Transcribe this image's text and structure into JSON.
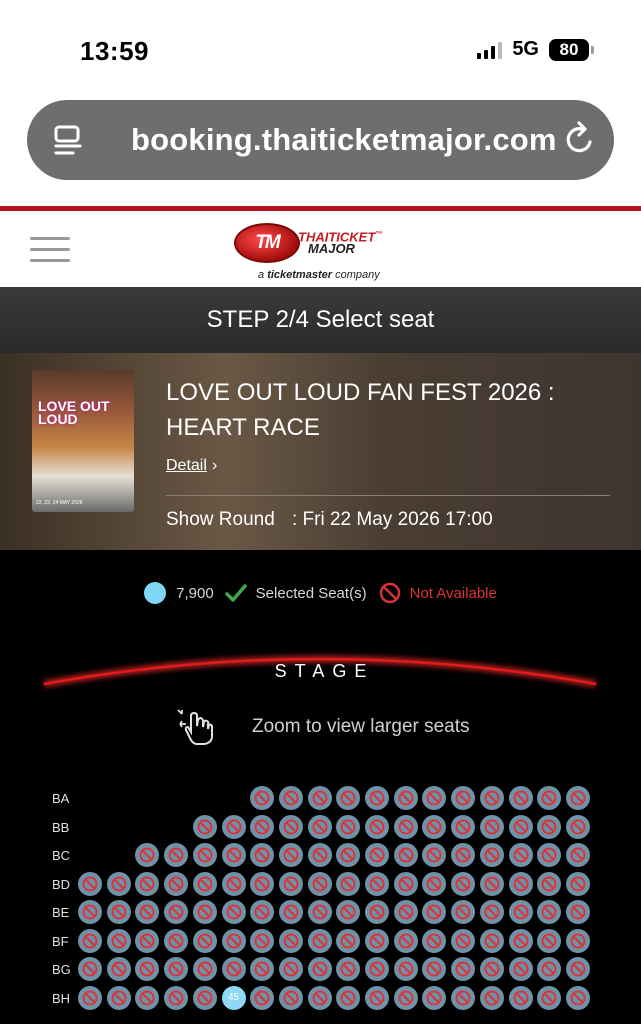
{
  "status_bar": {
    "time": "13:59",
    "network": "5G",
    "battery": "80"
  },
  "browser": {
    "url": "booking.thaiticketmajor.com",
    "left_icon": "reader-icon",
    "right_icon": "reload-icon"
  },
  "site": {
    "logo_badge": "TM",
    "logo_line1": "THAITICKET",
    "logo_line2": "MAJOR",
    "logo_tm": "™",
    "logo_sub_prefix": "a",
    "logo_sub_brand": "ticketmaster",
    "logo_sub_suffix": "company"
  },
  "step": {
    "label": "STEP 2/4 Select seat"
  },
  "event": {
    "poster_title": "LOVE OUT LOUD",
    "poster_dates": "22, 23, 24 MAY 2026",
    "title": "LOVE OUT LOUD FAN FEST 2026 : HEART RACE",
    "detail_label": "Detail",
    "show_round_label": "Show Round",
    "show_round_value": ": Fri 22 May 2026 17:00"
  },
  "legend": {
    "price": "7,900",
    "selected": "Selected Seat(s)",
    "not_available": "Not Available",
    "available_color": "#7fd6f5",
    "not_available_color": "#d9343a",
    "selected_color": "#3fa84a"
  },
  "stage": {
    "label": "STAGE",
    "zoom_hint": "Zoom to view larger seats"
  },
  "seat_rows": [
    {
      "label": "BA",
      "first_col": 6
    },
    {
      "label": "BB",
      "first_col": 4
    },
    {
      "label": "BC",
      "first_col": 2
    },
    {
      "label": "BD",
      "first_col": 0
    },
    {
      "label": "BE",
      "first_col": 0
    },
    {
      "label": "BF",
      "first_col": 0
    },
    {
      "label": "BG",
      "first_col": 0
    },
    {
      "label": "BH",
      "first_col": 0,
      "available_seat": {
        "col": 5,
        "number": "45"
      }
    }
  ],
  "seat_columns": 18
}
